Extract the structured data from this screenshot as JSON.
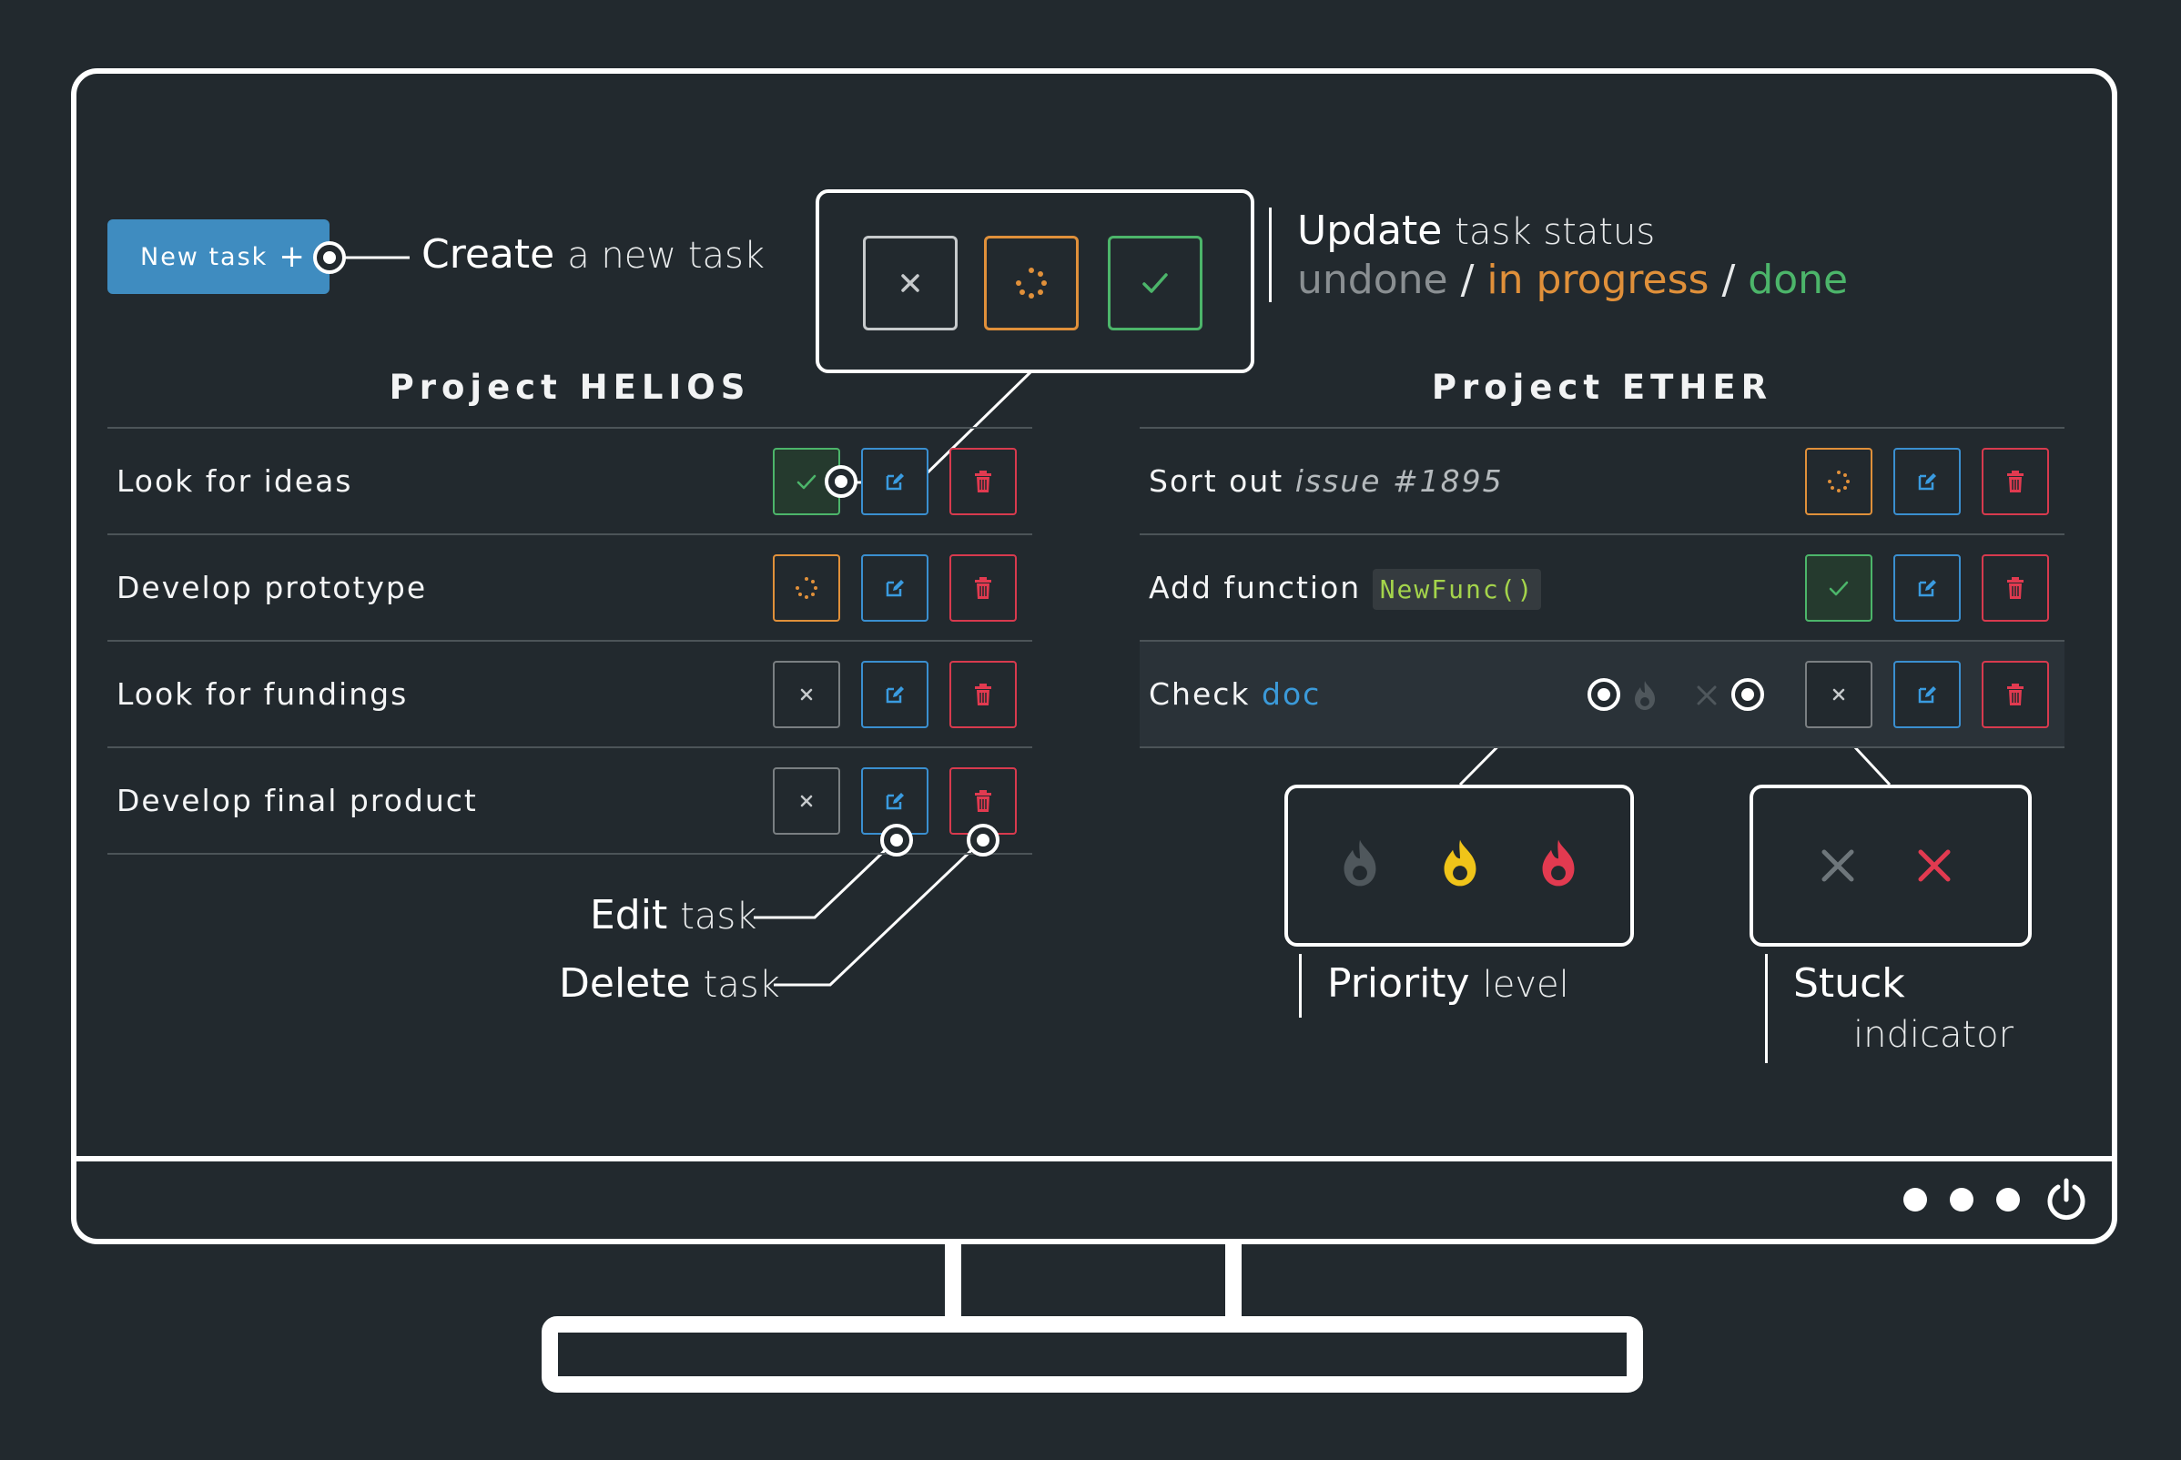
{
  "toolbar": {
    "new_task_label": "New task",
    "new_task_plus": "+"
  },
  "annotations": {
    "create_strong": "Create",
    "create_light": "a new task",
    "update_strong": "Update",
    "update_light": "task status",
    "status_undone": "undone",
    "status_sep1": "/",
    "status_progress": "in progress",
    "status_sep2": "/",
    "status_done": "done",
    "edit_strong": "Edit",
    "edit_light": "task",
    "delete_strong": "Delete",
    "delete_light": "task",
    "priority_strong": "Priority",
    "priority_light": "level",
    "stuck_strong": "Stuck",
    "stuck_light": "indicator"
  },
  "projects": [
    {
      "title": "Project HELIOS",
      "tasks": [
        {
          "label": "Look for ideas",
          "status": "done"
        },
        {
          "label": "Develop prototype",
          "status": "in-progress"
        },
        {
          "label": "Look for fundings",
          "status": "undone"
        },
        {
          "label": "Develop final product",
          "status": "undone"
        }
      ]
    },
    {
      "title": "Project ETHER",
      "tasks": [
        {
          "label": "Sort out",
          "issue": "issue #1895",
          "status": "in-progress"
        },
        {
          "label": "Add function",
          "code": "NewFunc()",
          "status": "done"
        },
        {
          "label": "Check",
          "link": "doc",
          "status": "undone"
        }
      ]
    }
  ],
  "colors": {
    "background": "#22292e",
    "primary": "#3f8cc0",
    "undone": "#7a7f82",
    "in_progress": "#e0903a",
    "done": "#4cb56a",
    "edit": "#3a8fd0",
    "delete": "#d83a4e",
    "priority_low": "#4f575c",
    "priority_medium": "#f0c419",
    "priority_high": "#e23a50"
  },
  "icons": {
    "undone": "close-icon",
    "in_progress": "spinner-icon",
    "done": "check-icon",
    "edit": "edit-icon",
    "delete": "trash-icon",
    "priority": "flame-icon",
    "stuck": "close-icon",
    "power": "power-icon"
  }
}
